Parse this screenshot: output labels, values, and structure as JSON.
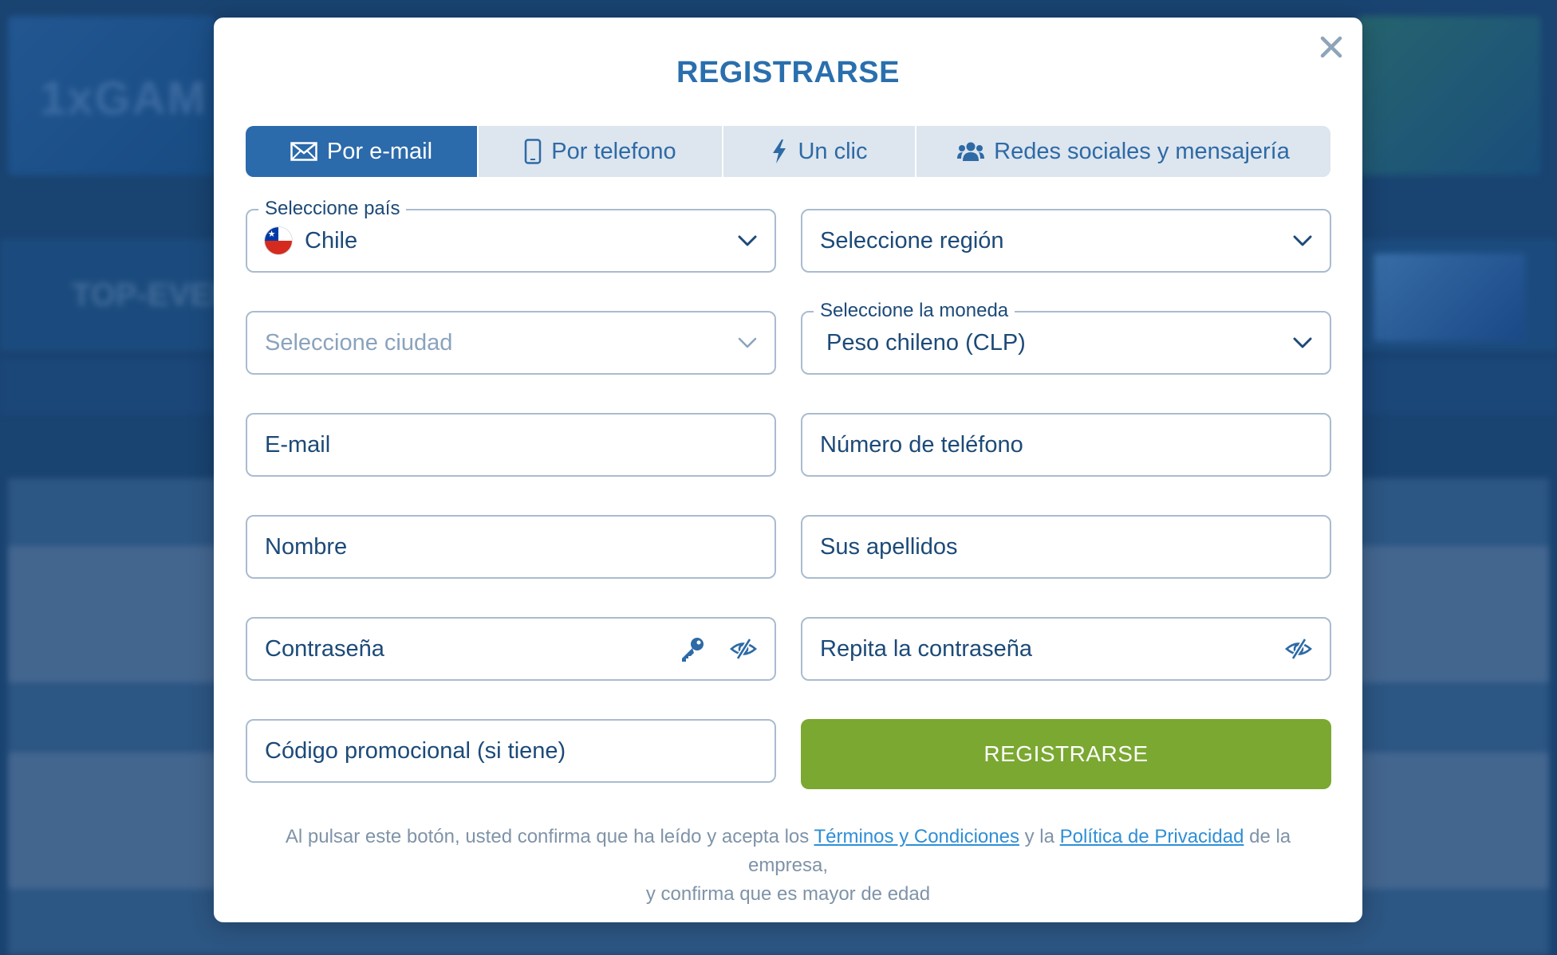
{
  "modal": {
    "title": "REGISTRARSE",
    "close_icon": "close-icon"
  },
  "tabs": [
    {
      "label": "Por e-mail",
      "icon": "envelope-icon",
      "active": true
    },
    {
      "label": "Por telefono",
      "icon": "mobile-phone-icon",
      "active": false
    },
    {
      "label": "Un clic",
      "icon": "lightning-icon",
      "active": false
    },
    {
      "label": "Redes sociales y mensajería",
      "icon": "users-icon",
      "active": false
    }
  ],
  "form": {
    "country": {
      "legend": "Seleccione país",
      "value": "Chile",
      "flag": "chile-flag-icon"
    },
    "region": {
      "placeholder": "Seleccione región"
    },
    "city": {
      "placeholder": "Seleccione ciudad"
    },
    "currency": {
      "legend": "Seleccione la moneda",
      "value": "Peso chileno (CLP)"
    },
    "email": {
      "placeholder": "E-mail"
    },
    "phone": {
      "placeholder": "Número de teléfono"
    },
    "first_name": {
      "placeholder": "Nombre"
    },
    "last_name": {
      "placeholder": "Sus apellidos"
    },
    "password": {
      "placeholder": "Contraseña"
    },
    "password_repeat": {
      "placeholder": "Repita la contraseña"
    },
    "promo": {
      "placeholder": "Código promocional (si tiene)"
    },
    "submit_label": "REGISTRARSE"
  },
  "terms": {
    "prefix": "Al pulsar este botón, usted confirma que ha leído y acepta los ",
    "terms_link": "Términos y Condiciones",
    "middle": " y la ",
    "privacy_link": "Política de Privacidad",
    "suffix": " de la empresa,",
    "line2": "y confirma que es mayor de edad"
  },
  "colors": {
    "brand_blue": "#2b6aab",
    "title_blue": "#2a6fad",
    "submit_green": "#7aa831",
    "tab_inactive_bg": "#dde5ee",
    "link_blue": "#2f8fd6"
  }
}
